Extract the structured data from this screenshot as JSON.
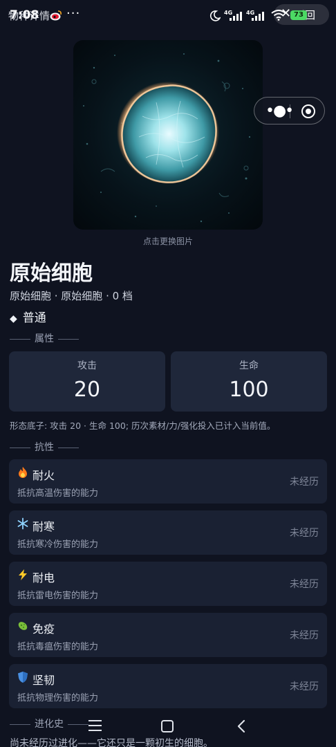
{
  "status_bar": {
    "time": "7:08",
    "page_title": "物种详情",
    "more": "···",
    "network_label_1": "4G",
    "network_label_2": "4G",
    "battery": "73",
    "back_x": "✕",
    "back_label": "返回"
  },
  "hero": {
    "caption": "点击更换图片"
  },
  "species": {
    "name": "原始细胞",
    "subtitle": "原始细胞 · 原始细胞 · 0 档",
    "rarity": "普通",
    "rarity_symbol": "◆"
  },
  "attributes": {
    "section_title": "属性",
    "stats": [
      {
        "label": "攻击",
        "value": "20"
      },
      {
        "label": "生命",
        "value": "100"
      }
    ],
    "note": "形态底子: 攻击 20 · 生命 100; 历次素材/力/强化投入已计入当前值。"
  },
  "resistances": {
    "section_title": "抗性",
    "items": [
      {
        "icon": "fire-icon",
        "name": "耐火",
        "desc": "抵抗高温伤害的能力",
        "status": "未经历"
      },
      {
        "icon": "snowflake-icon",
        "name": "耐寒",
        "desc": "抵抗寒冷伤害的能力",
        "status": "未经历"
      },
      {
        "icon": "lightning-icon",
        "name": "耐电",
        "desc": "抵抗雷电伤害的能力",
        "status": "未经历"
      },
      {
        "icon": "microbe-icon",
        "name": "免疫",
        "desc": "抵抗毒瘟伤害的能力",
        "status": "未经历"
      },
      {
        "icon": "shield-icon",
        "name": "坚韧",
        "desc": "抵抗物理伤害的能力",
        "status": "未经历"
      }
    ]
  },
  "history": {
    "section_title": "进化史",
    "text": "尚未经历过进化——它还只是一颗初生的细胞。"
  },
  "colors": {
    "background": "#0f1320",
    "card": "#1f273a",
    "resistance_card": "#1a2133",
    "battery": "#4cd964"
  }
}
